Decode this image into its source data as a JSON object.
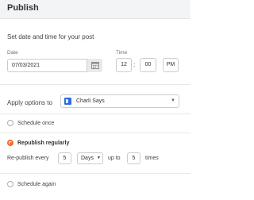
{
  "header": {
    "title": "Publish"
  },
  "schedule": {
    "section_title": "Set date and time for your post",
    "date_label": "Date",
    "date_value": "07/03/2021",
    "time_label": "Time",
    "hour": "12",
    "minute": "00",
    "ampm": "PM"
  },
  "apply": {
    "label": "Apply options to",
    "selected": "Charli Says",
    "brand_color": "#2d6cdf"
  },
  "options": {
    "schedule_once": "Schedule once",
    "republish_regularly": "Republish regularly",
    "schedule_again": "Schedule again",
    "selected": "republish_regularly",
    "accent_color": "#f26b2a"
  },
  "republish": {
    "prefix": "Re-publish every",
    "interval": "5",
    "unit": "Days",
    "up_to": "up to",
    "count": "5",
    "suffix": "times"
  }
}
